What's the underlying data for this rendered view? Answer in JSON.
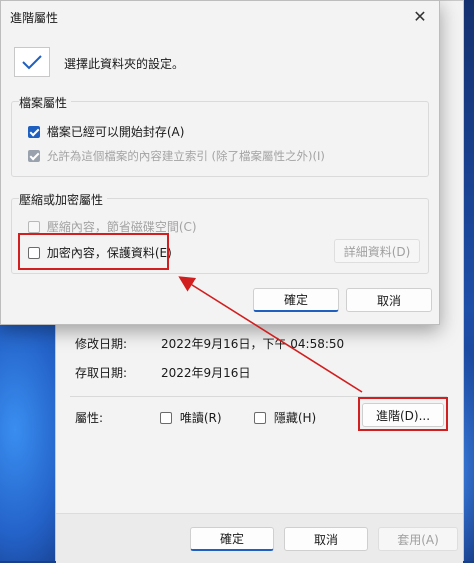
{
  "dialog": {
    "title": "進階屬性",
    "description": "選擇此資料夾的設定。",
    "archive_group": {
      "label": "檔案屬性",
      "archive_option": "檔案已經可以開始封存(A)",
      "index_option": "允許為這個檔案的內容建立索引 (除了檔案屬性之外)(I)"
    },
    "compress_group": {
      "label": "壓縮或加密屬性",
      "compress_option": "壓縮內容，節省磁碟空間(C)",
      "encrypt_option": "加密內容，保護資料(E)",
      "details_button": "詳細資料(D)"
    },
    "ok_button": "確定",
    "cancel_button": "取消"
  },
  "properties": {
    "modified_label": "修改日期:",
    "modified_value": "2022年9月16日，下午 04:58:50",
    "accessed_label": "存取日期:",
    "accessed_value": "2022年9月16日",
    "attributes_label": "屬性:",
    "readonly_option": "唯讀(R)",
    "hidden_option": "隱藏(H)",
    "advanced_button": "進階(D)...",
    "ok_button": "確定",
    "cancel_button": "取消",
    "apply_button": "套用(A)"
  },
  "colors": {
    "accent": "#1f5fbf",
    "highlight": "#d11e1e"
  }
}
